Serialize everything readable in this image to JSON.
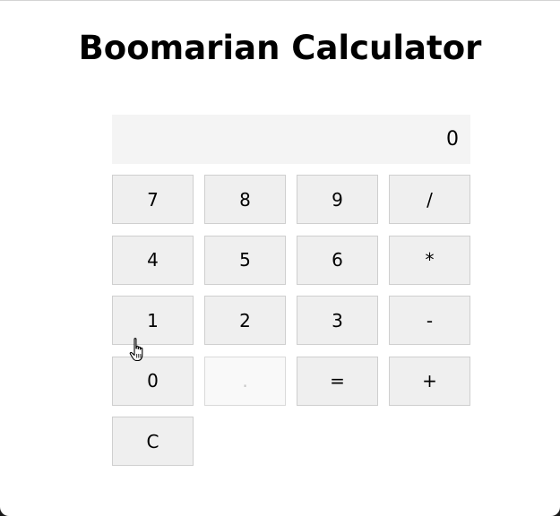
{
  "app": {
    "title": "Boomarian Calculator"
  },
  "display": {
    "value": "0"
  },
  "keys": [
    {
      "label": "7",
      "name": "key-7",
      "disabled": false
    },
    {
      "label": "8",
      "name": "key-8",
      "disabled": false
    },
    {
      "label": "9",
      "name": "key-9",
      "disabled": false
    },
    {
      "label": "/",
      "name": "divide-button",
      "disabled": false
    },
    {
      "label": "4",
      "name": "key-4",
      "disabled": false
    },
    {
      "label": "5",
      "name": "key-5",
      "disabled": false
    },
    {
      "label": "6",
      "name": "key-6",
      "disabled": false
    },
    {
      "label": "*",
      "name": "multiply-button",
      "disabled": false
    },
    {
      "label": "1",
      "name": "key-1",
      "disabled": false
    },
    {
      "label": "2",
      "name": "key-2",
      "disabled": false
    },
    {
      "label": "3",
      "name": "key-3",
      "disabled": false
    },
    {
      "label": "-",
      "name": "subtract-button",
      "disabled": false
    },
    {
      "label": "0",
      "name": "key-0",
      "disabled": false
    },
    {
      "label": ".",
      "name": "decimal-button",
      "disabled": true
    },
    {
      "label": "=",
      "name": "equals-button",
      "disabled": false
    },
    {
      "label": "+",
      "name": "add-button",
      "disabled": false
    },
    {
      "label": "C",
      "name": "clear-button",
      "disabled": false
    }
  ],
  "colors": {
    "display_bg": "#f4f4f4",
    "key_bg": "#efefef",
    "key_border": "#cfcfcf",
    "disabled_key_bg": "#f9f9f9",
    "disabled_key_text": "#c8c8c8"
  },
  "cursor": {
    "icon": "hand-pointer-icon"
  }
}
